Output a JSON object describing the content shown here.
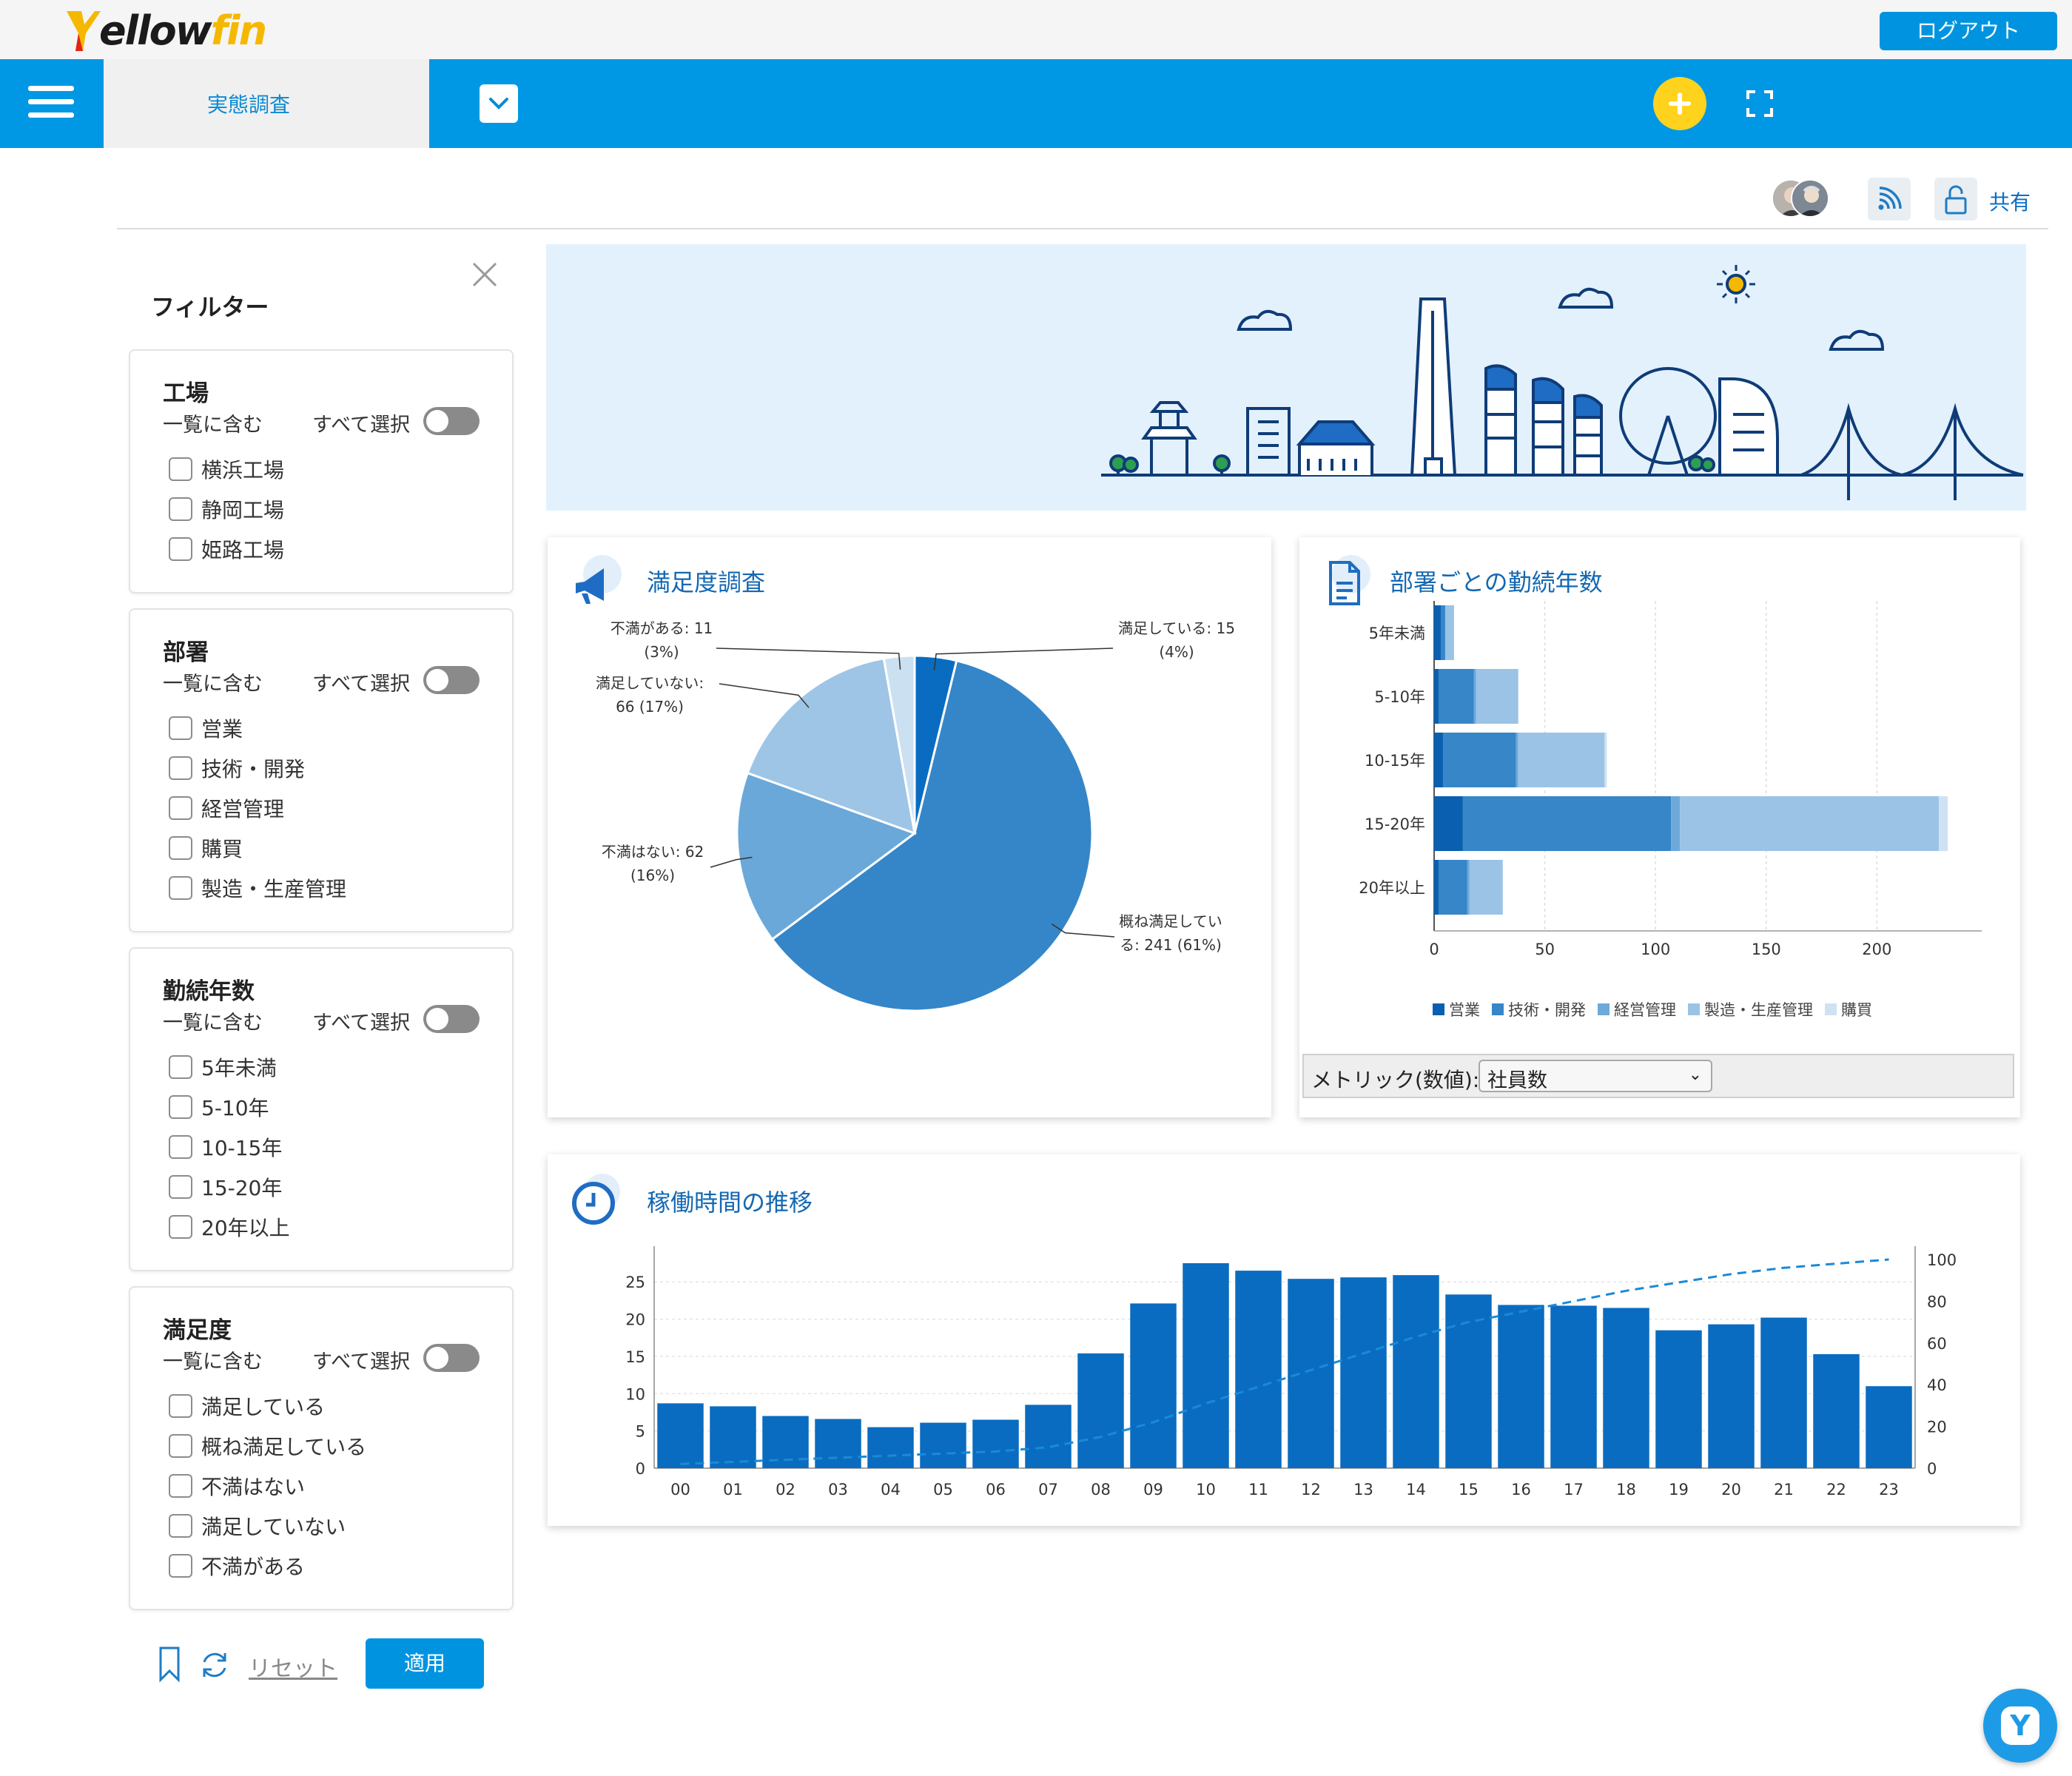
{
  "app": {
    "logo_text_a": "ellow",
    "logo_text_b": "fin",
    "logout_label": "ログアウト",
    "tab_label": "実態調査",
    "share_label": "共有",
    "colors": {
      "accent": "#0098e4",
      "brand_yellow": "#ffd21e",
      "title_blue": "#1468b2"
    }
  },
  "filters": {
    "title": "フィルター",
    "include_label": "一覧に含む",
    "select_all_label": "すべて選択",
    "groups": [
      {
        "title": "工場",
        "items": [
          "横浜工場",
          "静岡工場",
          "姫路工場"
        ]
      },
      {
        "title": "部署",
        "items": [
          "営業",
          "技術・開発",
          "経営管理",
          "購買",
          "製造・生産管理"
        ]
      },
      {
        "title": "勤続年数",
        "items": [
          "5年未満",
          "5-10年",
          "10-15年",
          "15-20年",
          "20年以上"
        ]
      },
      {
        "title": "満足度",
        "items": [
          "満足している",
          "概ね満足している",
          "不満はない",
          "満足していない",
          "不満がある"
        ]
      }
    ],
    "reset_label": "リセット",
    "apply_label": "適用"
  },
  "pie_card": {
    "title": "満足度調査"
  },
  "bar_card": {
    "title": "部署ごとの勤続年数",
    "metric_label": "メトリック(数値):",
    "metric_value": "社員数"
  },
  "line_card": {
    "title": "稼働時間の推移"
  },
  "chart_data": [
    {
      "type": "pie",
      "title": "満足度調査",
      "slices": [
        {
          "label": "満足している",
          "value": 15,
          "pct": "4%",
          "color": "#0a6cc0"
        },
        {
          "label": "概ね満足している",
          "value": 241,
          "pct": "61%",
          "color": "#3586c8"
        },
        {
          "label": "不満はない",
          "value": 62,
          "pct": "16%",
          "color": "#6aa8d9"
        },
        {
          "label": "満足していない",
          "value": 66,
          "pct": "17%",
          "color": "#9ec5e6"
        },
        {
          "label": "不満がある",
          "value": 11,
          "pct": "3%",
          "color": "#cbe0f1"
        }
      ],
      "data_labels": [
        [
          "満足している: 15",
          "(4%)"
        ],
        [
          "概ね満足してい",
          "る: 241 (61%)"
        ],
        [
          "不満はない: 62",
          "(16%)"
        ],
        [
          "満足していない:",
          "66 (17%)"
        ],
        [
          "不満がある: 11",
          "(3%)"
        ]
      ]
    },
    {
      "type": "bar",
      "orientation": "horizontal",
      "stacked": true,
      "title": "部署ごとの勤続年数",
      "categories": [
        "5年未満",
        "5-10年",
        "10-15年",
        "15-20年",
        "20年以上"
      ],
      "series": [
        {
          "name": "営業",
          "color": "#0a5fb0",
          "values": [
            3,
            2,
            4,
            13,
            2
          ]
        },
        {
          "name": "技術・開発",
          "color": "#3686c8",
          "values": [
            2,
            16,
            33,
            94,
            13
          ]
        },
        {
          "name": "経営管理",
          "color": "#6ea9da",
          "values": [
            0,
            1,
            1,
            4,
            1
          ]
        },
        {
          "name": "製造・生産管理",
          "color": "#9bc3e6",
          "values": [
            4,
            19,
            39,
            117,
            15
          ]
        },
        {
          "name": "購買",
          "color": "#cfe2f3",
          "values": [
            0,
            0,
            1,
            4,
            0
          ]
        }
      ],
      "xlim": [
        0,
        240
      ],
      "xticks": [
        0,
        50,
        100,
        150,
        200
      ],
      "legend_position": "bottom"
    },
    {
      "type": "bar",
      "title": "稼働時間の推移",
      "categories": [
        "00",
        "01",
        "02",
        "03",
        "04",
        "05",
        "06",
        "07",
        "08",
        "09",
        "10",
        "11",
        "12",
        "13",
        "14",
        "15",
        "16",
        "17",
        "18",
        "19",
        "20",
        "21",
        "22",
        "23"
      ],
      "series": [
        {
          "name": "bars",
          "color": "#0a6cc0",
          "values": [
            8.7,
            8.3,
            7.0,
            6.6,
            5.5,
            6.1,
            6.5,
            8.5,
            15.4,
            22.1,
            27.5,
            26.5,
            25.4,
            25.6,
            25.9,
            23.3,
            21.9,
            21.8,
            21.5,
            18.5,
            19.3,
            20.2,
            15.3,
            11.0
          ]
        },
        {
          "name": "cumulative",
          "type": "line",
          "dashed": true,
          "color": "#1a8ad8",
          "axis": "right",
          "values": [
            2,
            3,
            4,
            5,
            6,
            7,
            8,
            10,
            15,
            22,
            31,
            39,
            47,
            55,
            63,
            70,
            75,
            80,
            85,
            89,
            93,
            96,
            98,
            100
          ]
        }
      ],
      "ylim": [
        0,
        28
      ],
      "yticks": [
        0,
        5,
        10,
        15,
        20,
        25
      ],
      "y2lim": [
        0,
        100
      ],
      "y2ticks": [
        0,
        20,
        40,
        60,
        80,
        100
      ]
    }
  ]
}
